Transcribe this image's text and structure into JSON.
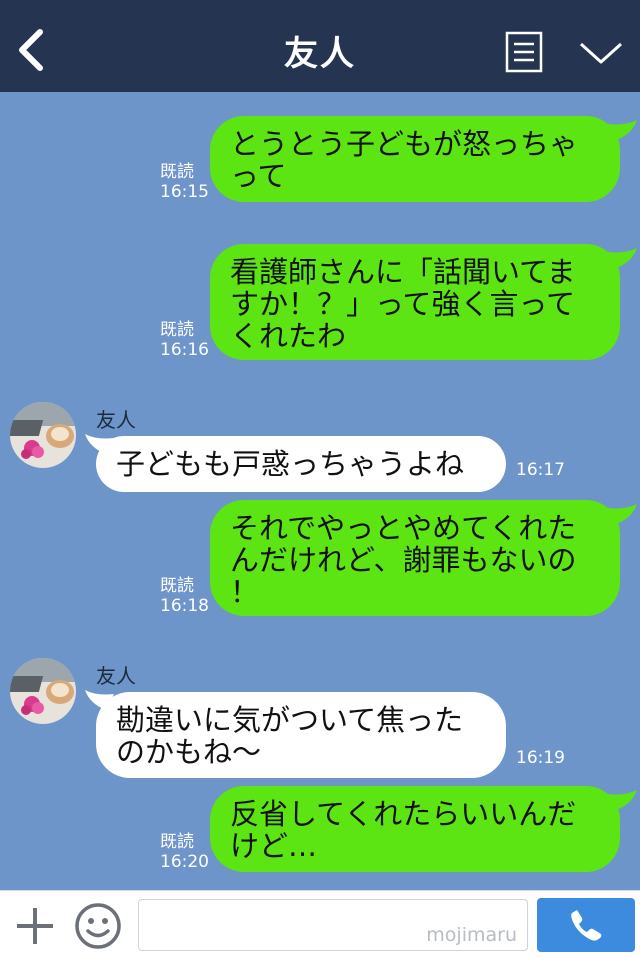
{
  "header": {
    "title": "友人"
  },
  "messages": [
    {
      "text": "とうとう子どもが怒っちゃ\nって",
      "read": "既読",
      "time": "16:15"
    },
    {
      "text": "看護師さんに「話聞いてま\nすか！？」って強く言って\nくれたわ",
      "read": "既読",
      "time": "16:16"
    },
    {
      "sender": "友人",
      "text": "子どもも戸惑っちゃうよね",
      "time": "16:17"
    },
    {
      "text": "それでやっとやめてくれた\nんだけれど、謝罪もないの\n！",
      "read": "既読",
      "time": "16:18"
    },
    {
      "sender": "友人",
      "text": "勘違いに気がついて焦った\nのかもね〜",
      "time": "16:19"
    },
    {
      "text": "反省してくれたらいいんだ\nけど…",
      "read": "既読",
      "time": "16:20"
    }
  ],
  "input": {
    "placeholder": "",
    "watermark": "mojimaru"
  },
  "colors": {
    "header": "#243451",
    "background": "#6e95c9",
    "outgoing_bubble": "#5de513",
    "incoming_bubble": "#ffffff",
    "call_button": "#3c8bde"
  },
  "icons": [
    "back-icon",
    "menu-icon",
    "chevron-down-icon",
    "plus-icon",
    "emoji-icon",
    "phone-icon"
  ]
}
